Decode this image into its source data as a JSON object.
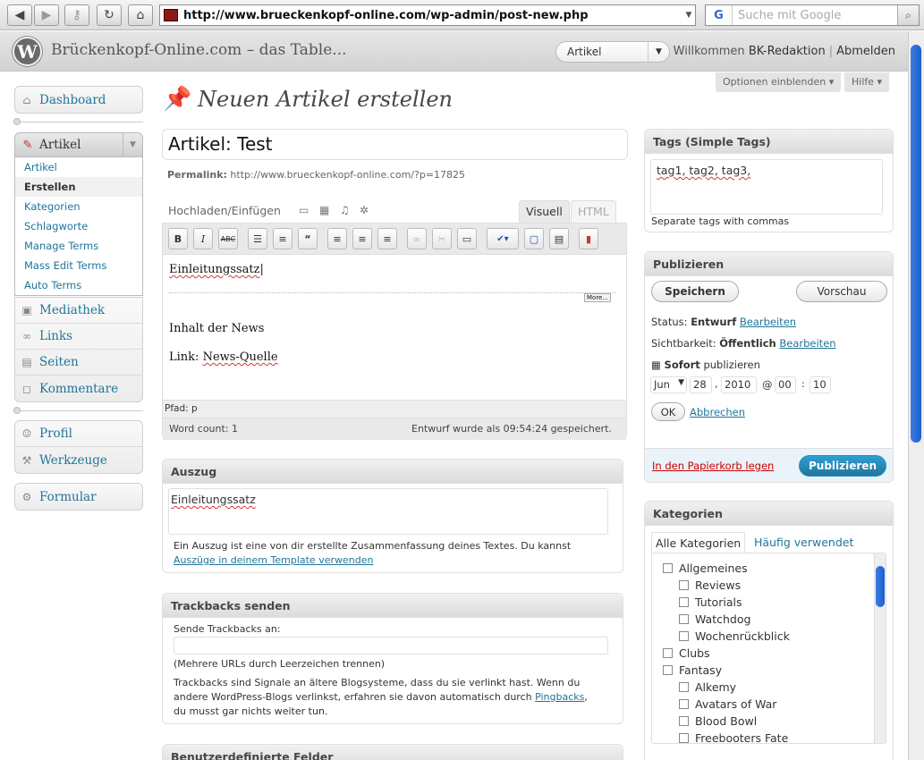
{
  "browser": {
    "url": "http://www.brueckenkopf-online.com/wp-admin/post-new.php",
    "search_placeholder": "Suche mit Google",
    "back": "◀",
    "forward": "▶",
    "reload": "↻",
    "home": "⌂"
  },
  "header": {
    "logo": "W",
    "site_title": "Brückenkopf-Online.com – das Table...",
    "favorite_action": "Artikel",
    "welcome": "Willkommen",
    "user": "BK-Redaktion",
    "logout": "Abmelden"
  },
  "screen_meta": {
    "options": "Optionen einblenden ▾",
    "help": "Hilfe ▾"
  },
  "sidebar": {
    "dashboard": "Dashboard",
    "artikel": "Artikel",
    "artikel_sub": [
      "Artikel",
      "Erstellen",
      "Kategorien",
      "Schlagworte",
      "Manage Terms",
      "Mass Edit Terms",
      "Auto Terms"
    ],
    "group2": [
      "Mediathek",
      "Links",
      "Seiten",
      "Kommentare"
    ],
    "group3": [
      "Profil",
      "Werkzeuge"
    ],
    "formular": "Formular"
  },
  "main": {
    "page_title": "Neuen Artikel erstellen",
    "post_title": "Artikel: Test",
    "permalink_label": "Permalink:",
    "permalink_url": "http://www.brueckenkopf-online.com/?p=17825",
    "upload_label": "Hochladen/Einfügen",
    "tab_visual": "Visuell",
    "tab_html": "HTML",
    "content": {
      "line1": "Einleitungssatz",
      "more": "More...",
      "line2": "Inhalt der News",
      "line3_prefix": "Link: ",
      "line3_link": "News-Quelle"
    },
    "path": "Pfad: p",
    "word_count": "Word count: 1",
    "draft_saved": "Entwurf wurde als 09:54:24 gespeichert."
  },
  "excerpt": {
    "title": "Auszug",
    "value": "Einleitungssatz",
    "help": "Ein Auszug ist eine von dir erstellte Zusammenfassung deines Textes. Du kannst",
    "help_link": "Auszüge in deinem Template verwenden"
  },
  "trackbacks": {
    "title": "Trackbacks senden",
    "label": "Sende Trackbacks an:",
    "hint": "(Mehrere URLs durch Leerzeichen trennen)",
    "desc1": "Trackbacks sind Signale an ältere Blogsysteme, dass du sie verlinkt hast. Wenn du",
    "desc2": "andere WordPress-Blogs verlinkst, erfahren sie davon automatisch durch",
    "desc_link": "Pingbacks",
    "desc3": "du musst gar nichts weiter tun."
  },
  "custom_fields": {
    "title": "Benutzerdefinierte Felder"
  },
  "tags": {
    "title": "Tags (Simple Tags)",
    "value": "tag1, tag2, tag3,",
    "hint": "Separate tags with commas"
  },
  "publish": {
    "title": "Publizieren",
    "save": "Speichern",
    "preview": "Vorschau",
    "status_label": "Status:",
    "status_value": "Entwurf",
    "visibility_label": "Sichtbarkeit:",
    "visibility_value": "Öffentlich",
    "edit": "Bearbeiten",
    "immediately": "Sofort",
    "publish_word": "publizieren",
    "month": "Jun",
    "day": "28",
    "year": "2010",
    "at": "@",
    "hour": "00",
    "minute": "10",
    "ok": "OK",
    "cancel": "Abbrechen",
    "trash": "In den Papierkorb legen",
    "publish_btn": "Publizieren"
  },
  "categories": {
    "title": "Kategorien",
    "tab_all": "Alle Kategorien",
    "tab_popular": "Häufig verwendet",
    "items": [
      {
        "label": "Allgemeines",
        "level": 0
      },
      {
        "label": "Reviews",
        "level": 1
      },
      {
        "label": "Tutorials",
        "level": 1
      },
      {
        "label": "Watchdog",
        "level": 1
      },
      {
        "label": "Wochenrückblick",
        "level": 1
      },
      {
        "label": "Clubs",
        "level": 0
      },
      {
        "label": "Fantasy",
        "level": 0
      },
      {
        "label": "Alkemy",
        "level": 1
      },
      {
        "label": "Avatars of War",
        "level": 1
      },
      {
        "label": "Blood Bowl",
        "level": 1
      },
      {
        "label": "Freebooters Fate",
        "level": 1
      }
    ]
  }
}
